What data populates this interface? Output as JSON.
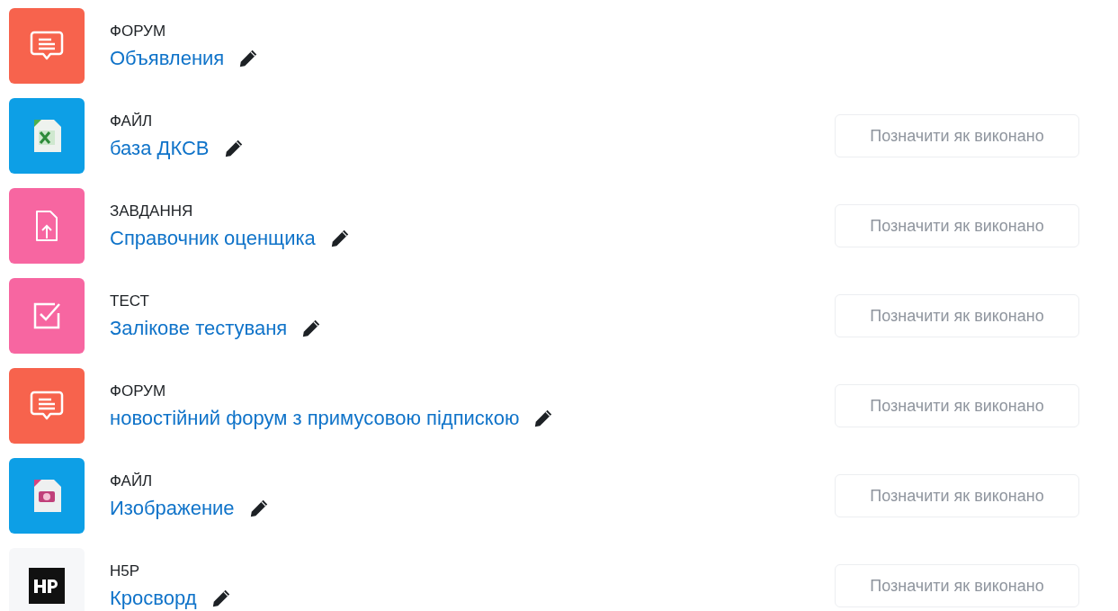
{
  "activities": [
    {
      "kind": "forum",
      "type": "ФОРУМ",
      "name": "Объявления"
    },
    {
      "kind": "spreadsheet",
      "type": "ФАЙЛ",
      "name": "база ДКСВ",
      "completion_button": "Позначити як виконано"
    },
    {
      "kind": "assign",
      "type": "ЗАВДАННЯ",
      "name": "Справочник оценщика",
      "completion_button": "Позначити як виконано"
    },
    {
      "kind": "quiz",
      "type": "ТЕСТ",
      "name": "Залікове тестуваня",
      "completion_button": "Позначити як виконано"
    },
    {
      "kind": "forum",
      "type": "ФОРУМ",
      "name": "новостійний форум з примусовою підпискою",
      "completion_button": "Позначити як виконано"
    },
    {
      "kind": "image",
      "type": "ФАЙЛ",
      "name": "Изображение",
      "completion_button": "Позначити як виконано"
    },
    {
      "kind": "h5p",
      "type": "H5P",
      "name": "Кросворд",
      "completion_button": "Позначити як виконано"
    }
  ]
}
